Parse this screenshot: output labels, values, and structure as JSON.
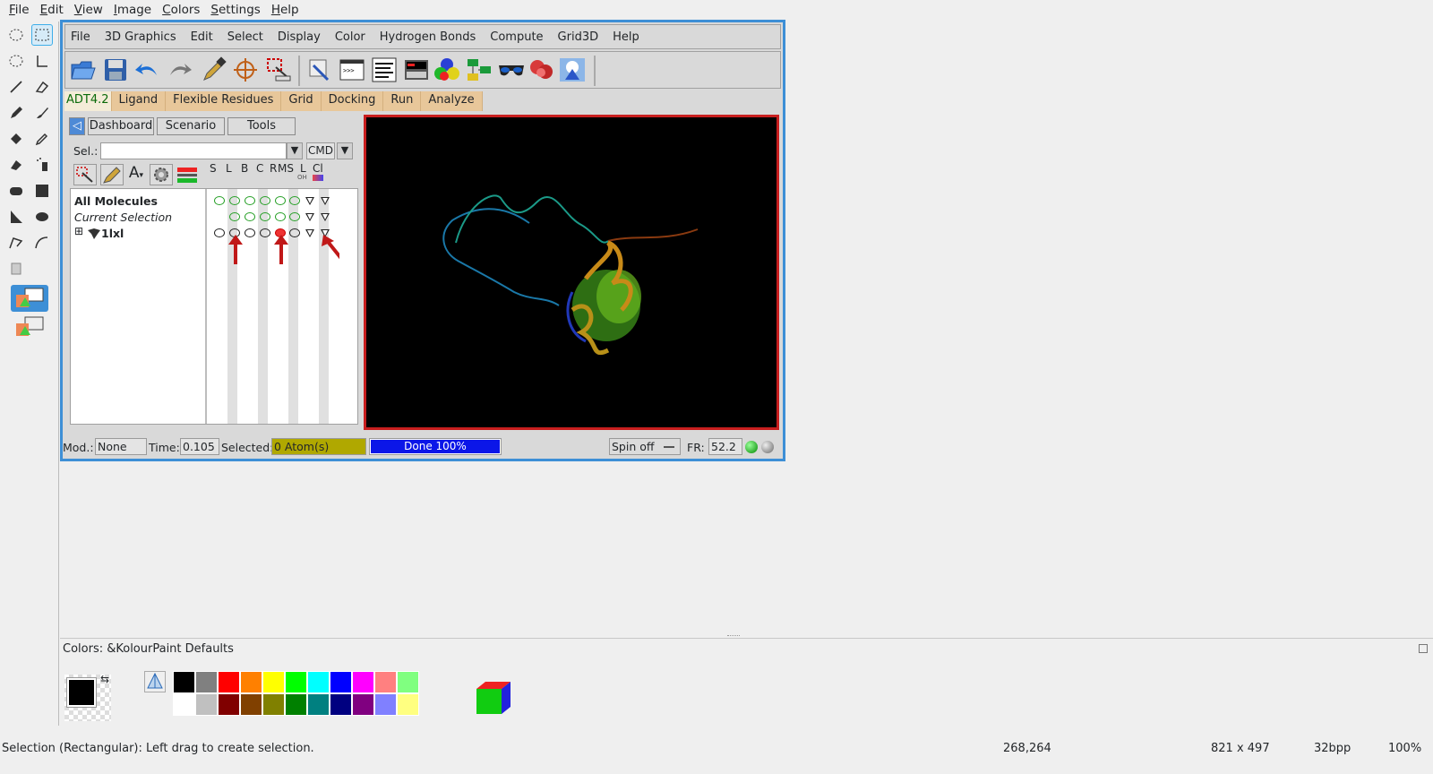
{
  "kp_menu": [
    "File",
    "Edit",
    "View",
    "Image",
    "Colors",
    "Settings",
    "Help"
  ],
  "adt_menu": [
    "File",
    "3D Graphics",
    "Edit",
    "Select",
    "Display",
    "Color",
    "Hydrogen Bonds",
    "Compute",
    "Grid3D",
    "Help"
  ],
  "adt_tabs": [
    "ADT4.2",
    "Ligand",
    "Flexible Residues",
    "Grid",
    "Docking",
    "Run",
    "Analyze"
  ],
  "dash_buttons": {
    "back": "◁",
    "dashboard": "Dashboard",
    "scenario": "Scenario",
    "tools": "Tools"
  },
  "sel_label": "Sel.:",
  "sel_value": "",
  "cmd_label": "CMD",
  "column_headers": [
    "S",
    "L",
    "B",
    "C",
    "R",
    "MS",
    "L",
    "Cl"
  ],
  "column_subheaders": [
    "OH"
  ],
  "tree": {
    "all": "All Molecules",
    "current": "Current Selection",
    "mol": "1lxl",
    "expander": "⊞"
  },
  "status": {
    "mod_label": "Mod.:",
    "mod_value": "None",
    "time_label": "Time:",
    "time_value": "0.105",
    "selected_label": "Selected:",
    "selected_value": "0 Atom(s)",
    "progress_label": "Done 100%",
    "progress": 1.0,
    "spin_label": "Spin off",
    "fr_label": "FR:",
    "fr_value": "52.2"
  },
  "colors_title": "Colors: &KolourPaint Defaults",
  "palette_top": [
    "#000000",
    "#808080",
    "#ff0000",
    "#ff8000",
    "#ffff00",
    "#00ff00",
    "#00ffff",
    "#0000ff",
    "#ff00ff",
    "#ff8080",
    "#80ff80"
  ],
  "palette_bottom": [
    "#ffffff",
    "#c0c0c0",
    "#800000",
    "#804000",
    "#808000",
    "#008000",
    "#008080",
    "#000080",
    "#800080",
    "#8080ff",
    "#ffff80"
  ],
  "kp_status": {
    "hint": "Selection (Rectangular): Left drag to create selection.",
    "coords": "268,264",
    "size": "821 x 497",
    "depth": "32bpp",
    "zoom": "100%"
  }
}
